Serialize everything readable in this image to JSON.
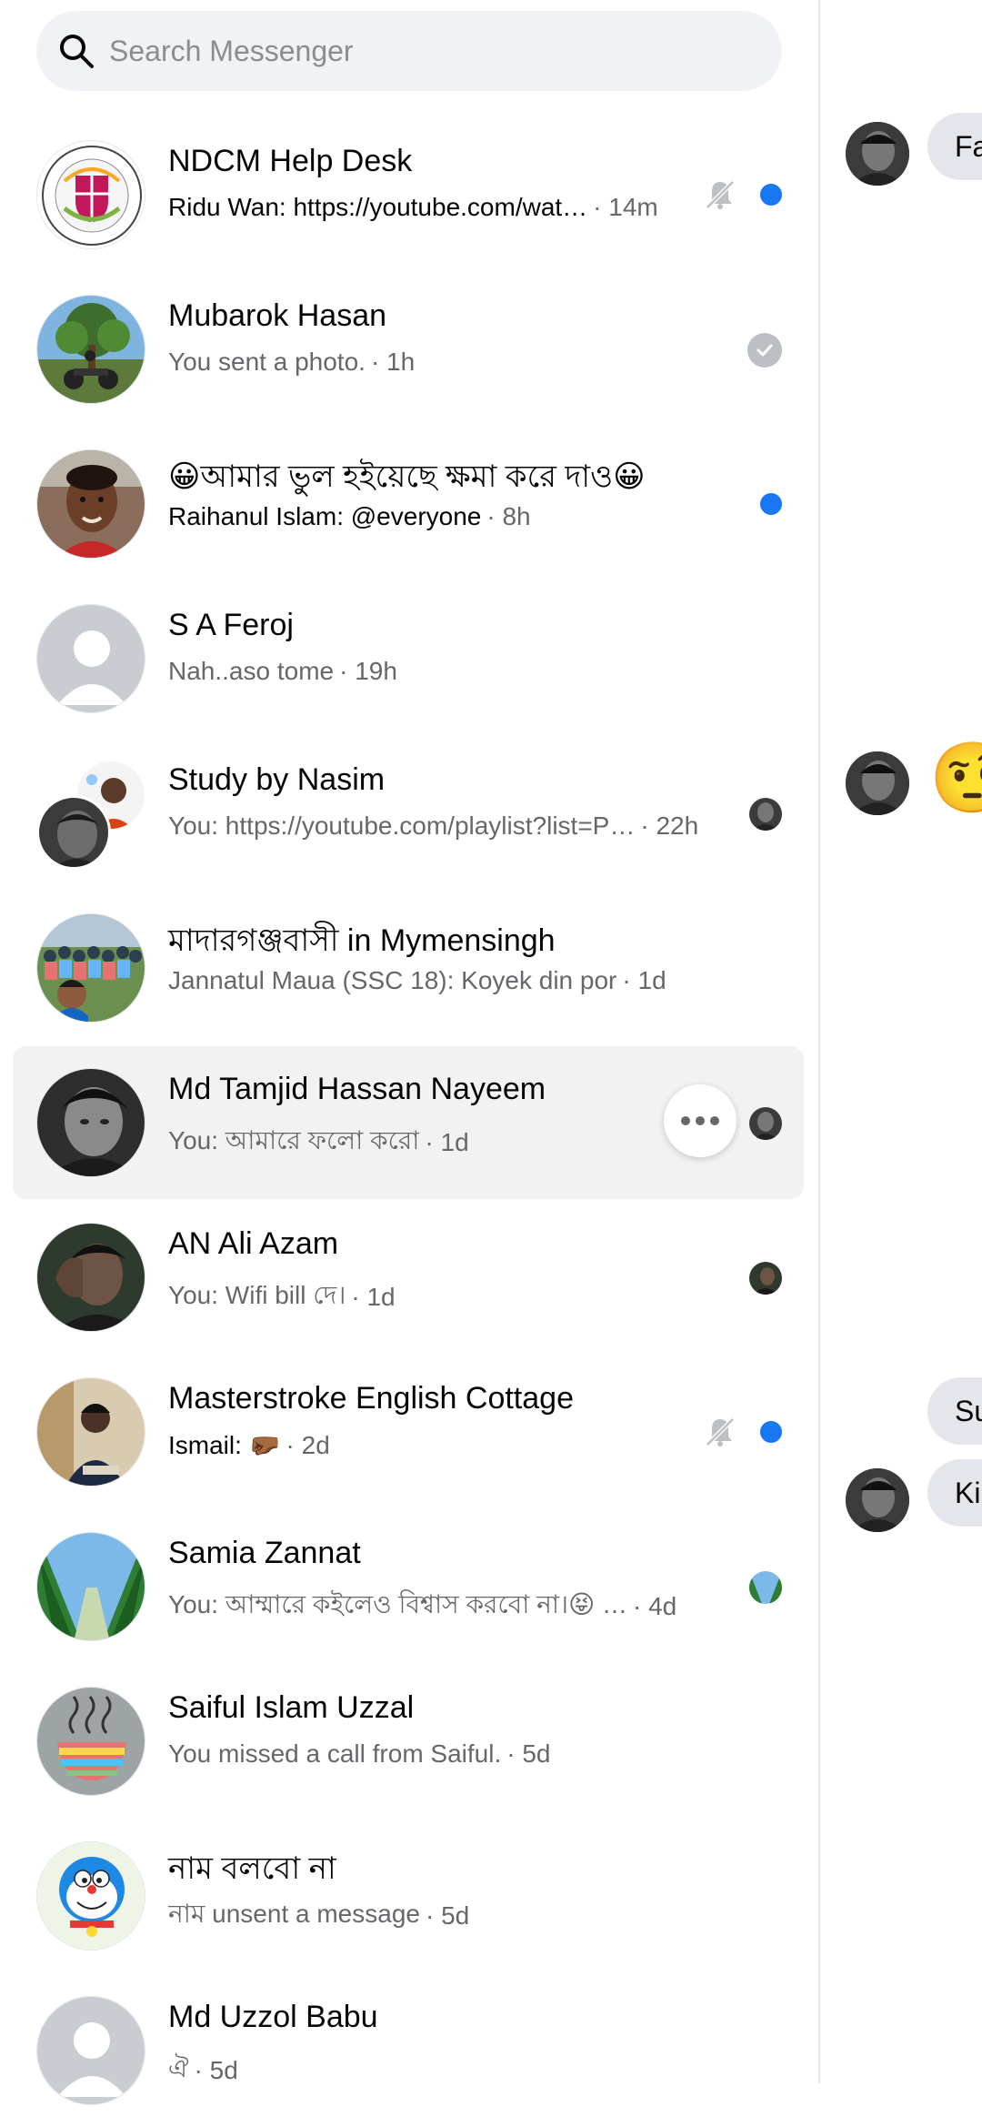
{
  "search": {
    "placeholder": "Search Messenger"
  },
  "chats": [
    {
      "name": "NDCM Help Desk",
      "preview": "Ridu Wan: https://youtube.com/wat…",
      "time": "· 14m",
      "unread": true,
      "muted": true
    },
    {
      "name": "Mubarok Hasan",
      "preview": "You sent a photo.",
      "time": "· 1h",
      "unread": false,
      "status": "sent"
    },
    {
      "name": "😀আমার ভুল হইয়েছে ক্ষমা করে দাও😀",
      "preview": "Raihanul Islam: @everyone",
      "time": "· 8h",
      "unread": true
    },
    {
      "name": "S A Feroj",
      "preview": "Nah..aso tome",
      "time": "· 19h",
      "unread": false
    },
    {
      "name": "Study by Nasim",
      "preview": "You: https://youtube.com/playlist?list=P…",
      "time": "· 22h",
      "unread": false,
      "status": "seen"
    },
    {
      "name": "মাদারগঞ্জবাসী in Mymensingh",
      "preview": "Jannatul Maua (SSC 18): Koyek din por",
      "time": "· 1d",
      "unread": false
    },
    {
      "name": "Md Tamjid Hassan Nayeem",
      "preview": "You: আমারে ফলো করো",
      "time": "· 1d",
      "unread": false,
      "status": "seen",
      "hovered": true
    },
    {
      "name": "AN Ali Azam",
      "preview": "You: Wifi bill দে।",
      "time": "· 1d",
      "unread": false,
      "status": "seen"
    },
    {
      "name": "Masterstroke English Cottage",
      "preview": "Ismail: 🤛🏾",
      "time": "· 2d",
      "unread": true,
      "muted": true
    },
    {
      "name": "Samia Zannat",
      "preview": "You: আম্মারে কইলেও বিশ্বাস করবো না।😝 …",
      "time": "· 4d",
      "unread": false,
      "status": "seen"
    },
    {
      "name": "Saiful Islam Uzzal",
      "preview": "You missed a call from Saiful.",
      "time": "· 5d",
      "unread": false
    },
    {
      "name": "নাম বলবো না",
      "preview": "নাম unsent a message",
      "time": "· 5d",
      "unread": false
    },
    {
      "name": "Md Uzzol Babu",
      "preview": "ঐ",
      "time": "· 5d",
      "unread": false
    }
  ],
  "right_pane": {
    "bubbles": [
      "Fa",
      "Su",
      "Ki"
    ],
    "emoji": "🤨"
  },
  "colors": {
    "unread_dot": "#1877f2",
    "search_bg": "#f0f2f5",
    "hover_bg": "#f2f2f2"
  }
}
